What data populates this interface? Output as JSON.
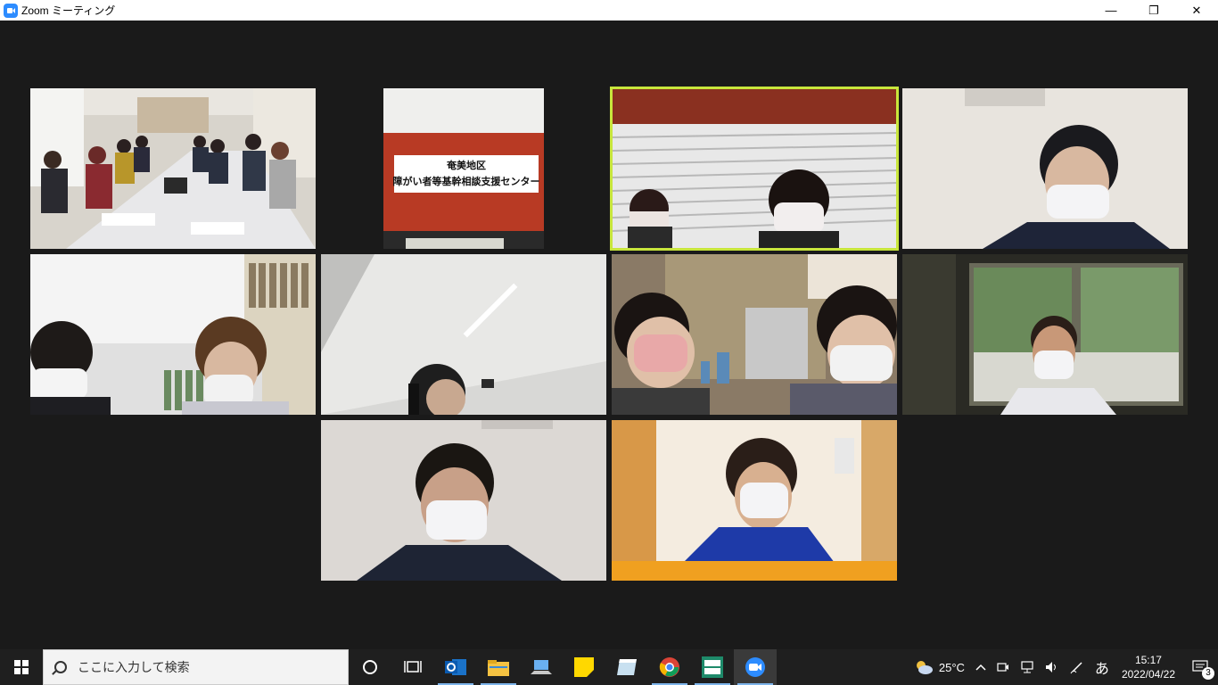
{
  "window": {
    "title": "Zoom ミーティング",
    "minimize": "—",
    "maximize": "❐",
    "close": "✕"
  },
  "meeting": {
    "active_speaker_color": "#c8e63c",
    "tiles": [
      {
        "id": "conference-room"
      },
      {
        "id": "sign",
        "sign_line1": "奄美地区",
        "sign_line2": "障がい者等基幹相談支援センター"
      },
      {
        "id": "two-women-blinds",
        "active": true
      },
      {
        "id": "man-mask"
      },
      {
        "id": "two-women-bookshelf"
      },
      {
        "id": "ceiling-man-headset"
      },
      {
        "id": "two-women-shelf"
      },
      {
        "id": "man-window"
      },
      {
        "id": "man-earphones"
      },
      {
        "id": "woman-headset"
      }
    ]
  },
  "taskbar": {
    "search_placeholder": "ここに入力して検索",
    "weather_temp": "25°C",
    "ime_label": "あ",
    "time": "15:17",
    "date": "2022/04/22",
    "notification_count": "3",
    "apps": [
      "cortana-icon",
      "task-view-icon",
      "outlook-icon",
      "file-explorer-icon",
      "remote-desktop-icon",
      "sticky-notes-icon",
      "notes-app-icon",
      "chrome-icon",
      "legato-app-icon",
      "zoom-icon"
    ]
  }
}
